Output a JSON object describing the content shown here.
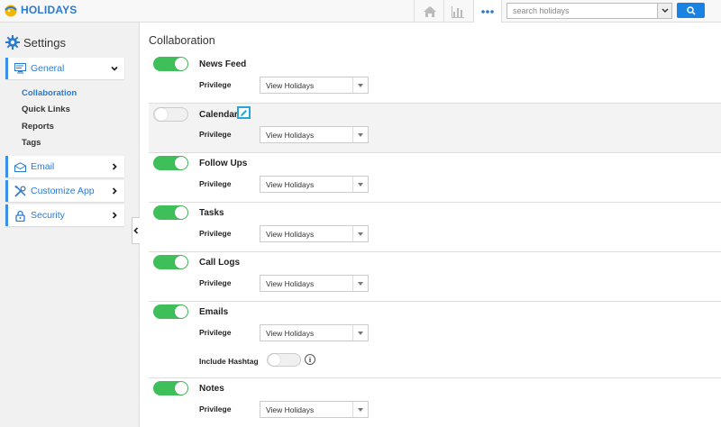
{
  "app": {
    "name": "HOLIDAYS"
  },
  "search": {
    "placeholder": "search holidays"
  },
  "sidebar": {
    "title": "Settings",
    "nav": [
      {
        "label": "General",
        "icon": "monitor-icon",
        "expanded": true
      },
      {
        "label": "Email",
        "icon": "envelope-icon"
      },
      {
        "label": "Customize App",
        "icon": "tools-icon"
      },
      {
        "label": "Security",
        "icon": "lock-icon"
      }
    ],
    "subitems": [
      {
        "label": "Collaboration",
        "active": true
      },
      {
        "label": "Quick Links"
      },
      {
        "label": "Reports"
      },
      {
        "label": "Tags"
      }
    ]
  },
  "main": {
    "title": "Collaboration",
    "privilege_label": "Privilege",
    "rows": [
      {
        "title": "News Feed",
        "enabled": true,
        "privilege": "View Holidays"
      },
      {
        "title": "Calendar",
        "enabled": false,
        "privilege": "View Holidays"
      },
      {
        "title": "Follow Ups",
        "enabled": true,
        "privilege": "View Holidays"
      },
      {
        "title": "Tasks",
        "enabled": true,
        "privilege": "View Holidays"
      },
      {
        "title": "Call Logs",
        "enabled": true,
        "privilege": "View Holidays"
      },
      {
        "title": "Emails",
        "enabled": true,
        "privilege": "View Holidays",
        "extra_label": "Include Hashtag",
        "extra_enabled": false
      },
      {
        "title": "Notes",
        "enabled": true,
        "privilege": "View Holidays"
      }
    ],
    "info_glyph": "i"
  },
  "colors": {
    "accent": "#2a7ad2",
    "toggle_on": "#3fbf5a",
    "search_button": "#1a82e2"
  }
}
